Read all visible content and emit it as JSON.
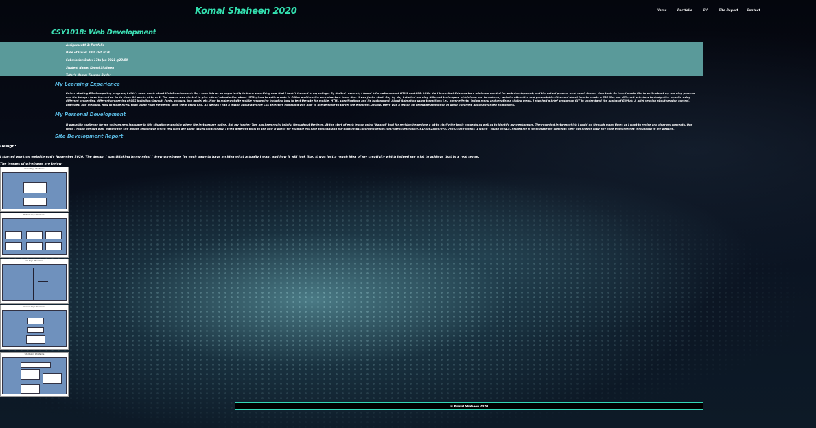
{
  "header": {
    "site_title": "Komal Shaheen 2020",
    "nav": [
      "Home",
      "Portfolio",
      "CV",
      "Site Report",
      "Contact"
    ]
  },
  "page": {
    "course_title": "CSY1018: Web Development"
  },
  "info_panel": {
    "assignment": "Assignment# 1: Portfolio",
    "date_of_issue": "Date of Issue: 28th Oct 2020",
    "submission_date": "Submission Date: 17th Jan 2021 @23:59",
    "student_name": "Student Name: Komal Shaheen",
    "tutor_name": "Tutor's Name: Thomas Butler"
  },
  "learning": {
    "heading": "My Learning Experience",
    "text": "Before starting B3a Computing program, I didn't know much about Web Development. So, I took this as an opportunity to learn something new that I hadn't learned in my college. By limited research, I found information about HTML and CSS. Little did I know that this was bare minimum needed for web development, and the actual process went much deeper than that. So here I would like to write about my learning process and the things I have learned so far in these 10 weeks of term 1. The course was started to give a brief introduction about HTML, how to write a code in Editor and how the web structure looks like. It was just a start. Day-by-day I started learning different techniques which I can use to make my website attractive and presentable. I learned about how to create a CSS file, use different selectors to design the website using different properties, different properties of CSS including; Layout, Fonts, colours, box model etc. How to make website mobile responsive including how to test the site for mobile, HTML specifications and its background. About Animation using transitions i.e., hover effects, fading menu and creating a sliding menu. I also had a brief session on GIT to understand the basics of GitHub. A brief session about version control, branches, and merging. How to make HTML form using Form elements, style them using CSS. As well as I had a lesson about advance CSS selectors explained well how to use selector to target the elements. At last, there was a lesson on keyframe animation in which I learned about advanced animations."
  },
  "personal": {
    "heading": "My Personal Development",
    "text": "It was a big challenge for me to learn new language in this situation especially where the lectures are online. But my teacher Tom has been really helpful throughout the term. At the start of each lesson using \"Kahoot\" tool for revision helped me a lot to clarify the basic concepts as well as to identify my weaknesses. The recorded lectures which I could go through many times as I want to revise and clear my concepts. One thing I found difficult was, making the site mobile responsive which few ways are same issues occasionally. I tried different tools to see how it works for example YouTube tutorials and a E-book https://learning.oreilly.com/videos/learning/9781788623056/9781788623056-video1_1 which I found on VLE, helped me a lot to make my concepts clear but I never copy any code from internet throughout in my website."
  },
  "report": {
    "heading": "Site Development Report",
    "design_label": "Design:",
    "design_text": "I started work on website early November 2020. The design I was thinking in my mind I drew wireframe for each page to have an idea what actually I want and how it will look like. It was just a rough idea of my creativity which helped me a lot to achieve that in a real sense.",
    "wireframes_caption": "The images of wireframe are below:",
    "wireframe_titles": [
      "Home Page Wireframe",
      "Portfolio Page Wireframe",
      "CV Page Wireframe",
      "Contact Page Wireframe",
      "Site Report Wireframe"
    ]
  },
  "footer": {
    "text": "© Komal Shaheen 2020"
  }
}
